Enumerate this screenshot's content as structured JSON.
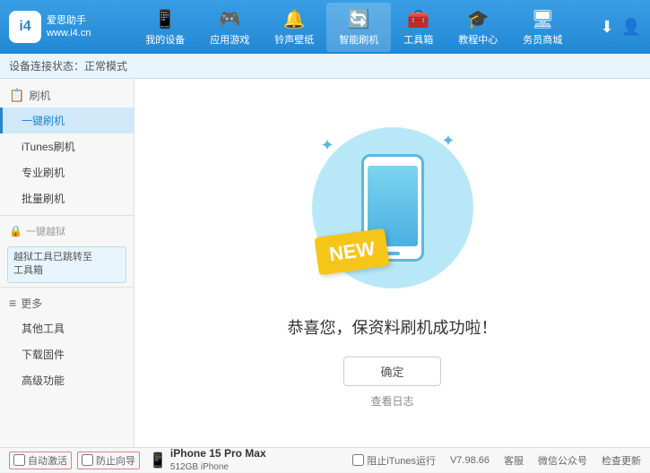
{
  "header": {
    "logo_text1": "爱思助手",
    "logo_text2": "www.i4.cn",
    "logo_abbr": "i4",
    "nav": [
      {
        "id": "my-devices",
        "label": "我的设备",
        "icon": "📱"
      },
      {
        "id": "apps-games",
        "label": "应用游戏",
        "icon": "👤"
      },
      {
        "id": "ringtones",
        "label": "铃声壁纸",
        "icon": "🔔"
      },
      {
        "id": "smart-flash",
        "label": "智能刷机",
        "icon": "🔄",
        "active": true
      },
      {
        "id": "toolbox",
        "label": "工具箱",
        "icon": "🧰"
      },
      {
        "id": "tutorials",
        "label": "教程中心",
        "icon": "🎓"
      },
      {
        "id": "business",
        "label": "务员商城",
        "icon": "🖥"
      }
    ],
    "download_icon": "⬇",
    "user_icon": "👤"
  },
  "toolbar": {
    "label": "设备连接状态：",
    "status": "正常模式"
  },
  "sidebar": {
    "sections": [
      {
        "id": "flash",
        "header": "刷机",
        "header_icon": "📋",
        "items": [
          {
            "id": "one-click-flash",
            "label": "一键刷机",
            "active": true
          },
          {
            "id": "itunes-flash",
            "label": "iTunes刷机"
          },
          {
            "id": "pro-flash",
            "label": "专业刷机"
          },
          {
            "id": "batch-flash",
            "label": "批量刷机"
          }
        ]
      },
      {
        "id": "one-key-jailbreak",
        "header": "一键越狱",
        "header_icon": "🔒",
        "disabled": true,
        "notice": "越狱工具已跳转至\n工具箱"
      },
      {
        "id": "more",
        "header": "更多",
        "header_icon": "≡",
        "items": [
          {
            "id": "other-tools",
            "label": "其他工具"
          },
          {
            "id": "download-firmware",
            "label": "下载固件"
          },
          {
            "id": "advanced",
            "label": "高级功能"
          }
        ]
      }
    ]
  },
  "content": {
    "success_text": "恭喜您，保资料刷机成功啦！",
    "confirm_label": "确定",
    "view_log_label": "查看日志",
    "new_badge": "NEW"
  },
  "bottom": {
    "auto_activate_label": "自动激活",
    "time_guide_label": "防止向导",
    "device_name": "iPhone 15 Pro Max",
    "device_storage": "512GB",
    "device_type": "iPhone",
    "itunes_label": "阻止iTunes运行",
    "version": "V7.98.66",
    "links": [
      "客服",
      "微信公众号",
      "检查更新"
    ]
  }
}
